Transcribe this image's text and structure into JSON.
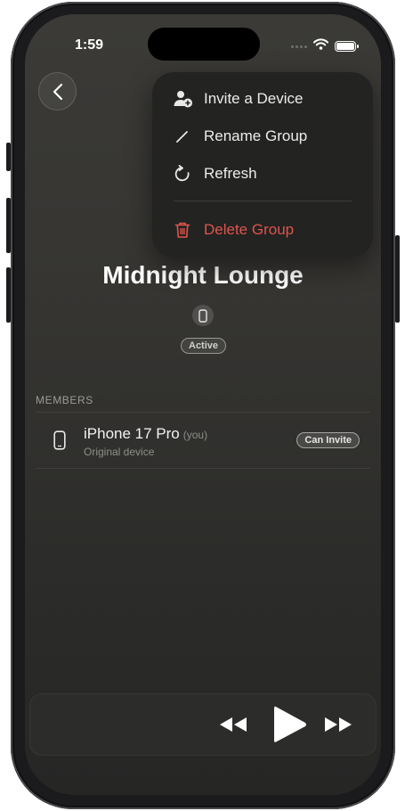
{
  "status": {
    "time": "1:59"
  },
  "menu": {
    "items": [
      {
        "label": "Invite a Device",
        "icon": "person-add-icon"
      },
      {
        "label": "Rename Group",
        "icon": "pencil-icon"
      },
      {
        "label": "Refresh",
        "icon": "refresh-icon"
      },
      {
        "label": "Delete Group",
        "icon": "trash-icon",
        "color": "#e0544c"
      }
    ]
  },
  "group": {
    "title": "Midnight Lounge",
    "status": "Active"
  },
  "members": {
    "header": "MEMBERS",
    "items": [
      {
        "name": "iPhone 17 Pro",
        "tag": "(you)",
        "subtitle": "Original device",
        "badge": "Can Invite"
      }
    ]
  },
  "colors": {
    "accent_danger": "#e0544c",
    "background": "#363532"
  }
}
